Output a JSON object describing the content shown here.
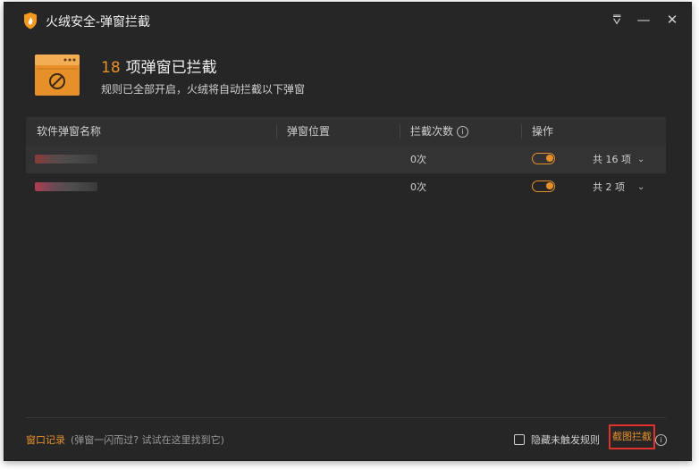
{
  "window": {
    "title": "火绒安全-弹窗拦截",
    "controls": {
      "menu": "⩢",
      "minimize": "—",
      "close": "✕"
    }
  },
  "header": {
    "count": "18",
    "title": "项弹窗已拦截",
    "subtitle": "规则已全部开启，火绒将自动拦截以下弹窗",
    "icon": "window-block-icon"
  },
  "table": {
    "columns": [
      "软件弹窗名称",
      "弹窗位置",
      "拦截次数",
      "操作"
    ],
    "info_glyph": "i",
    "rows": [
      {
        "name_blurred": true,
        "blur_color": "#8a3a3a",
        "count": "0次",
        "enabled": true,
        "total": "共 16 项",
        "chevron": "⌄"
      },
      {
        "name_blurred": true,
        "blur_color": "#b23c52",
        "count": "0次",
        "enabled": true,
        "total": "共 2 项",
        "chevron": "⌄"
      }
    ]
  },
  "footer": {
    "log_link": "窗口记录",
    "log_hint": "(弹窗一闪而过? 试试在这里找到它)",
    "hide_rules_label": "隐藏未触发规则",
    "screenshot_block": "截图拦截",
    "info_glyph": "i"
  },
  "colors": {
    "accent": "#e7902a",
    "background": "#262626",
    "highlight_box": "#e0322a"
  }
}
